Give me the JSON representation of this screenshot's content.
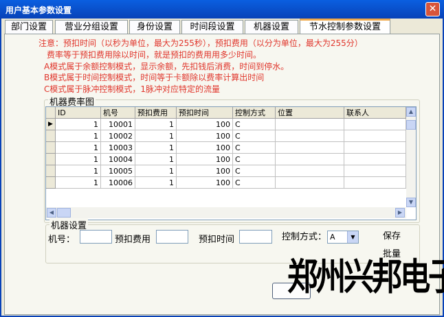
{
  "window": {
    "title": "用户基本参数设置",
    "close_label": "✕"
  },
  "tabs": [
    {
      "label": "部门设置"
    },
    {
      "label": "营业分组设置"
    },
    {
      "label": "身份设置"
    },
    {
      "label": "时间段设置"
    },
    {
      "label": "机器设置"
    },
    {
      "label": "节水控制参数设置",
      "active": true
    }
  ],
  "notes": [
    "注意：预扣时间（以秒为单位，最大为255秒），预扣费用（以分为单位，最大为255分）",
    "费率等于预扣费用除以时间，就是预扣的费用用多少时间。",
    "A模式属于余额控制模式，显示余额，先扣钱后消费，时间到停水。",
    "B模式属于时间控制模式，时间等于卡额除以费率计算出时间",
    "C模式属于脉冲控制模式，1脉冲对应特定的流量"
  ],
  "grid_group": {
    "label": "机器费率图",
    "columns": [
      "ID",
      "机号",
      "预扣费用",
      "预扣时间",
      "控制方式",
      "位置",
      "联系人"
    ],
    "rows": [
      [
        "1",
        "10001",
        "1",
        "100",
        "C",
        "",
        ""
      ],
      [
        "1",
        "10002",
        "1",
        "100",
        "C",
        "",
        ""
      ],
      [
        "1",
        "10003",
        "1",
        "100",
        "C",
        "",
        ""
      ],
      [
        "1",
        "10004",
        "1",
        "100",
        "C",
        "",
        ""
      ],
      [
        "1",
        "10005",
        "1",
        "100",
        "C",
        "",
        ""
      ],
      [
        "1",
        "10006",
        "1",
        "100",
        "C",
        "",
        ""
      ]
    ],
    "current_row_marker": "▶"
  },
  "machine_settings": {
    "label": "机器设置",
    "machine_no_label": "机号：",
    "prepay_fee_label": "预扣费用",
    "prepay_time_label": "预扣时间",
    "control_mode_label": "控制方式：",
    "control_mode_value": "A",
    "save_label": "保存",
    "batch_label": "批量"
  },
  "watermark": "郑州兴邦电子",
  "icons": {
    "dropdown": "chevron-down-icon",
    "close": "close-icon"
  }
}
